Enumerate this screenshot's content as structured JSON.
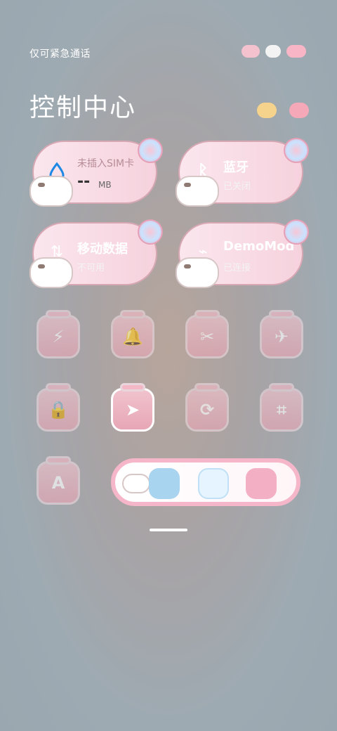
{
  "status": {
    "left_text": "仅可紧急通话",
    "right_icons": [
      "cloud-bars-icon",
      "wifi-cat-icon",
      "candy-icon"
    ]
  },
  "header": {
    "title": "控制中心",
    "decorations": [
      "candy-icon",
      "heart-candy-icon"
    ]
  },
  "cards": [
    {
      "id": "data-usage",
      "label": "未插入SIM卡",
      "value": "--",
      "unit": "MB",
      "icon": "drop-icon"
    },
    {
      "id": "bluetooth",
      "label": "蓝牙",
      "sub": "已关闭",
      "icon": "bluetooth-icon"
    },
    {
      "id": "mobile-data",
      "label": "移动数据",
      "sub": "不可用",
      "icon": "signal-icon"
    },
    {
      "id": "wifi",
      "label": "DemoMod",
      "sub": "已连接",
      "icon": "wifi-icon"
    }
  ],
  "toggles_row1": [
    {
      "id": "flashlight",
      "glyph": "⚡",
      "icon": "flashlight-icon"
    },
    {
      "id": "bell",
      "glyph": "🔔",
      "icon": "bell-icon"
    },
    {
      "id": "screenshot",
      "glyph": "✂",
      "icon": "screenshot-icon"
    },
    {
      "id": "airplane",
      "glyph": "✈",
      "icon": "airplane-icon"
    }
  ],
  "toggles_row2": [
    {
      "id": "lock",
      "glyph": "🔒",
      "icon": "lock-icon"
    },
    {
      "id": "location",
      "glyph": "➤",
      "icon": "location-icon"
    },
    {
      "id": "rotate",
      "glyph": "⟳",
      "icon": "rotation-lock-icon"
    },
    {
      "id": "scan",
      "glyph": "⌗",
      "icon": "scan-icon"
    }
  ],
  "toggle_row3": {
    "id": "font",
    "glyph": "A",
    "icon": "font-icon"
  },
  "theme_bar": {
    "items": [
      "hamster-icon",
      "blue-bear-icon",
      "white-bear-icon",
      "pink-bear-icon"
    ]
  },
  "colors": {
    "card_bg": "#f6d2dd",
    "card_border": "#d7a8b4",
    "jar_pink": "#e7a6b5"
  }
}
